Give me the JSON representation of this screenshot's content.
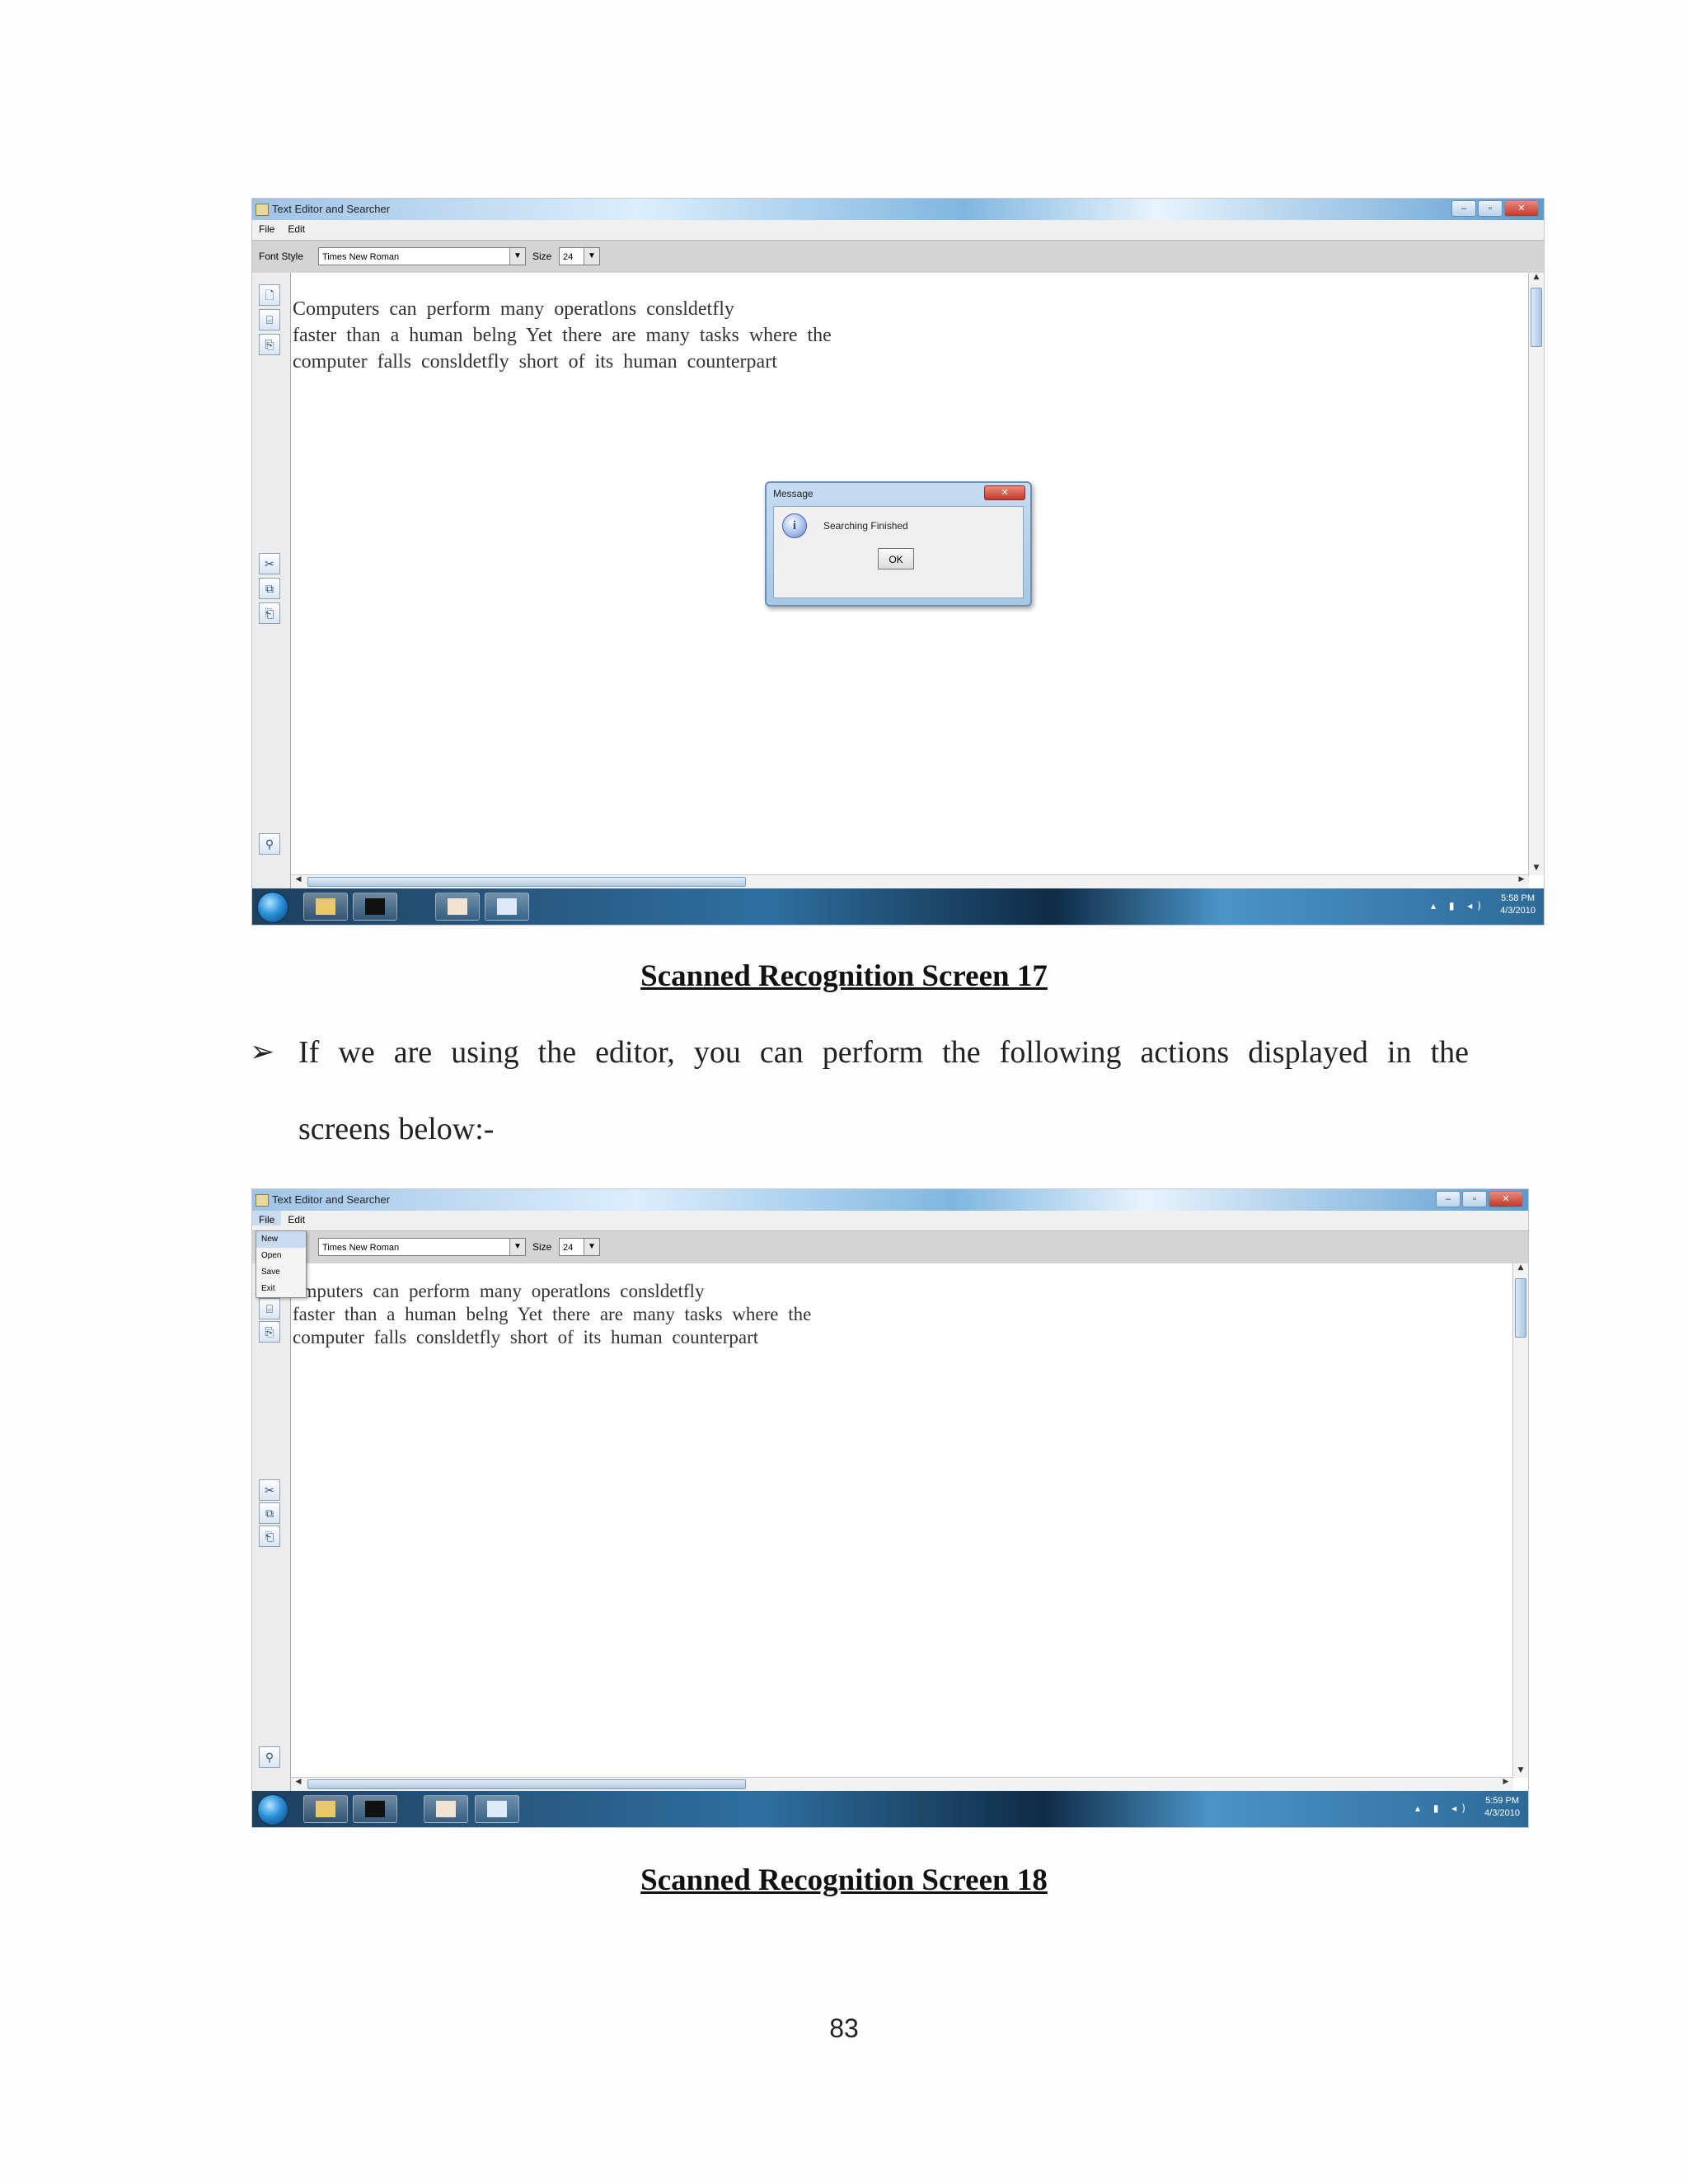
{
  "screen17": {
    "window_title": "Text Editor and Searcher",
    "menu": [
      "File",
      "Edit"
    ],
    "font_style_label": "Font Style",
    "font_style_value": "Times New Roman",
    "size_label": "Size",
    "size_value": "24",
    "text_lines": [
      "Computers can perform many operatlons consldetfly",
      "faster than a human belng Yet there are many tasks where the",
      "computer falls consldetfly short of its human counterpart"
    ],
    "dialog": {
      "title": "Message",
      "message": "Searching Finished",
      "ok": "OK"
    },
    "clock_time": "5:58 PM",
    "clock_date": "4/3/2010"
  },
  "caption1": "Scanned Recognition Screen 17",
  "bullet": {
    "line1": "If we are using the editor, you can perform the following actions displayed in the",
    "line2": "screens below:-"
  },
  "screen18": {
    "window_title": "Text Editor and Searcher",
    "menu": [
      "File",
      "Edit"
    ],
    "file_menu_items": [
      "New",
      "Open",
      "Save",
      "Exit"
    ],
    "font_style_value": "Times New Roman",
    "size_label": "Size",
    "size_value": "24",
    "text_lines": [
      "omputers can perform many operatlons consldetfly",
      "faster than a human belng Yet there are many tasks where the",
      "computer falls consldetfly short of its human counterpart"
    ],
    "clock_time": "5:59 PM",
    "clock_date": "4/3/2010"
  },
  "caption2": "Scanned Recognition Screen 18",
  "page_number": "83"
}
